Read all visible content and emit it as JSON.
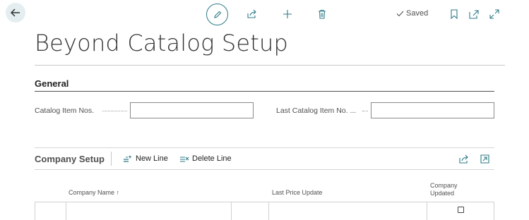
{
  "toolbar": {
    "saved_label": "Saved"
  },
  "page": {
    "title": "Beyond Catalog Setup"
  },
  "general": {
    "title": "General",
    "fields": [
      {
        "label": "Catalog Item Nos.",
        "value": ""
      },
      {
        "label": "Last Catalog Item No. ...",
        "value": ""
      }
    ]
  },
  "company_setup": {
    "title": "Company Setup",
    "actions": {
      "new_line": "New Line",
      "delete_line": "Delete Line"
    },
    "columns": {
      "company_name": "Company Name ↑",
      "last_price_update": "Last Price Update",
      "company_updated_line1": "Company",
      "company_updated_line2": "Updated"
    },
    "rows": [
      {
        "company_name": "",
        "last_price_update": "",
        "company_updated": false
      }
    ]
  },
  "colors": {
    "accent": "#2c7a86",
    "back_button_bg": "#e4eef0"
  }
}
